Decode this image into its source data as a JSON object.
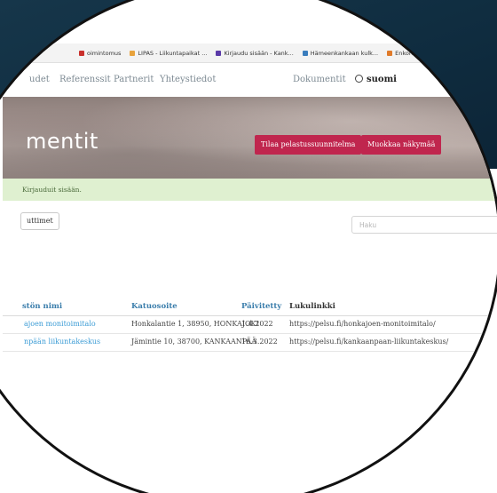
{
  "bookmarks": [
    {
      "label": "oimintomus",
      "color": "#c9302c"
    },
    {
      "label": "LIPAS - Liikuntapaikat ...",
      "color": "#e8a33d"
    },
    {
      "label": "Kirjaudu sisään - Kank...",
      "color": "#5a3aa8"
    },
    {
      "label": "Hämeenkankaan kulk...",
      "color": "#3a7dbd"
    },
    {
      "label": "Enkora asiakasp",
      "color": "#e07b2a"
    }
  ],
  "nav": {
    "items": [
      "udet",
      "Referenssit",
      "Partnerit",
      "Yhteystiedot"
    ],
    "documents": "Dokumentit",
    "language": "suomi"
  },
  "hero": {
    "title": "mentit",
    "order_button": "Tilaa pelastussuunnitelma",
    "edit_button": "Muokkaa näkymää"
  },
  "alert": {
    "message": "Kirjauduit sisään."
  },
  "toolbar": {
    "filter_button": "uttimet",
    "search_placeholder": "Haku"
  },
  "table": {
    "columns": [
      "stön nimi",
      "Katuosoite",
      "Päivitetty",
      "Lukulinkki"
    ],
    "rows": [
      {
        "name": "ajoen monitoimitalo",
        "address": "Honkalantie 1, 38950, HONKAJOKI",
        "updated": "1.4.2022",
        "link": "https://pelsu.fi/honkajoen-monitoimitalo/"
      },
      {
        "name": "npään liikuntakeskus",
        "address": "Jämintie 10, 38700, KANKAANPÄÄ",
        "updated": "16.3.2022",
        "link": "https://pelsu.fi/kankaanpaan-liikuntakeskus/"
      }
    ]
  }
}
